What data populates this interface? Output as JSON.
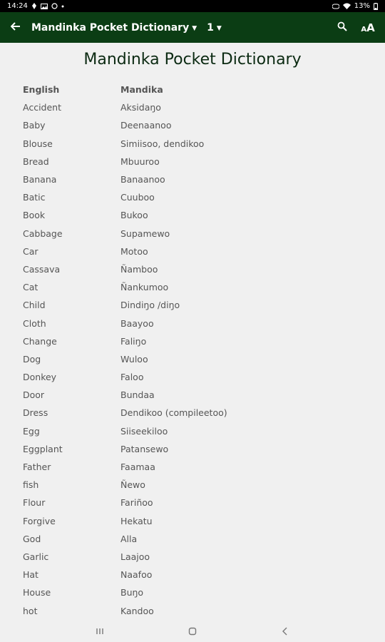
{
  "status_bar": {
    "time": "14:24",
    "battery": "13%"
  },
  "app_bar": {
    "title": "Mandinka Pocket Dictionary",
    "page": "1"
  },
  "document": {
    "title": "Mandinka Pocket Dictionary",
    "headers": {
      "english": "English",
      "mandinka": "Mandika"
    },
    "rows": [
      {
        "en": "Accident",
        "md": "Aksidaŋo"
      },
      {
        "en": "Baby",
        "md": "Deenaanoo"
      },
      {
        "en": "Blouse",
        "md": "Simiisoo, dendikoo"
      },
      {
        "en": "Bread",
        "md": "Mbuuroo"
      },
      {
        "en": "Banana",
        "md": "Banaanoo"
      },
      {
        "en": "Batic",
        "md": "Cuuboo"
      },
      {
        "en": "Book",
        "md": "Bukoo"
      },
      {
        "en": "Cabbage",
        "md": "Supamewo"
      },
      {
        "en": "Car",
        "md": "Motoo"
      },
      {
        "en": "Cassava",
        "md": "Ñamboo"
      },
      {
        "en": "Cat",
        "md": "Ñankumoo"
      },
      {
        "en": "Child",
        "md": "Dindiŋo /diŋo"
      },
      {
        "en": "Cloth",
        "md": "Baayoo"
      },
      {
        "en": "Change",
        "md": "Faliŋo"
      },
      {
        "en": "Dog",
        "md": "Wuloo"
      },
      {
        "en": "Donkey",
        "md": "Faloo"
      },
      {
        "en": "Door",
        "md": "Bundaa"
      },
      {
        "en": "Dress",
        "md": "Dendikoo (compileetoo)"
      },
      {
        "en": "Egg",
        "md": "Siiseekiloo"
      },
      {
        "en": "Eggplant",
        "md": "Patansewo"
      },
      {
        "en": "Father",
        "md": "Faamaa"
      },
      {
        "en": "fish",
        "md": "Ñewo"
      },
      {
        "en": "Flour",
        "md": "Fariñoo"
      },
      {
        "en": "Forgive",
        "md": "Hekatu"
      },
      {
        "en": "God",
        "md": "Alla"
      },
      {
        "en": "Garlic",
        "md": "Laajoo"
      },
      {
        "en": "Hat",
        "md": "Naafoo"
      },
      {
        "en": "House",
        "md": "Buŋo"
      },
      {
        "en": "hot",
        "md": "Kandoo"
      }
    ]
  },
  "icons": {
    "back": "back-arrow-icon",
    "search": "search-icon",
    "font_size": "font-size-icon"
  }
}
